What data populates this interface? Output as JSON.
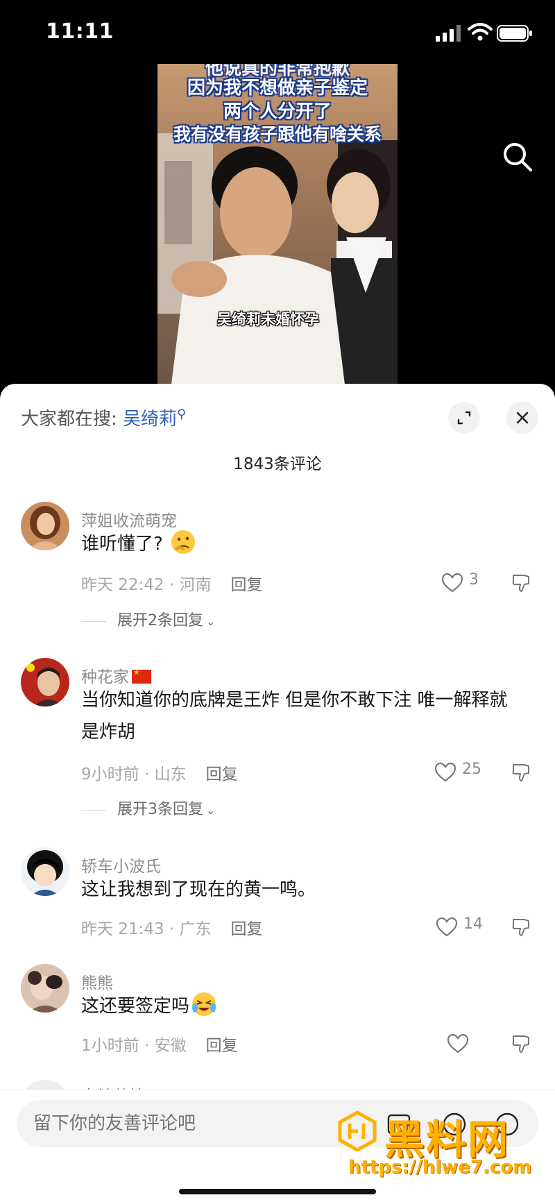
{
  "status_bar": {
    "time": "11:11"
  },
  "video": {
    "caption_lines": [
      "因为我不想做亲子鉴定",
      "两个人分开了",
      "我有没有孩子跟他有啥关系"
    ],
    "caption_top_partial": "他说真的非常抱歉",
    "subtitle": "吴绮莉未婚怀孕"
  },
  "comments_panel": {
    "hot_search_prefix": "大家都在搜:",
    "hot_search_term": "吴绮莉",
    "comment_count": "1843条评论",
    "comments": [
      {
        "username": "萍姐收流萌宠",
        "text": "谁听懂了?",
        "emoji": "thinking-face",
        "time_location": "昨天 22:42 · 河南",
        "reply_label": "回复",
        "likes": "3",
        "expand_label": "展开2条回复"
      },
      {
        "username": "种花家",
        "text": "当你知道你的底牌是王炸  但是你不敢下注  唯一解释就是炸胡",
        "time_location": "9小时前 · 山东",
        "reply_label": "回复",
        "likes": "25",
        "expand_label": "展开3条回复"
      },
      {
        "username": "轿车小波氏",
        "text": "这让我想到了现在的黄一鸣。",
        "time_location": "昨天 21:43 · 广东",
        "reply_label": "回复",
        "likes": "14"
      },
      {
        "username": "熊熊",
        "text": "这还要签定吗",
        "emoji": "crying-laughing-face",
        "time_location": "1小时前 · 安徽",
        "reply_label": "回复",
        "likes": ""
      },
      {
        "username": "白糖芝桔"
      }
    ]
  },
  "input_bar": {
    "placeholder": "留下你的友善评论吧"
  },
  "watermark": {
    "title": "黑料网",
    "url": "https://hlwe7.com"
  },
  "colors": {
    "accent_link": "#2f5fb5",
    "watermark": "#ffb100",
    "caption_outline": "#1b3b8c"
  }
}
